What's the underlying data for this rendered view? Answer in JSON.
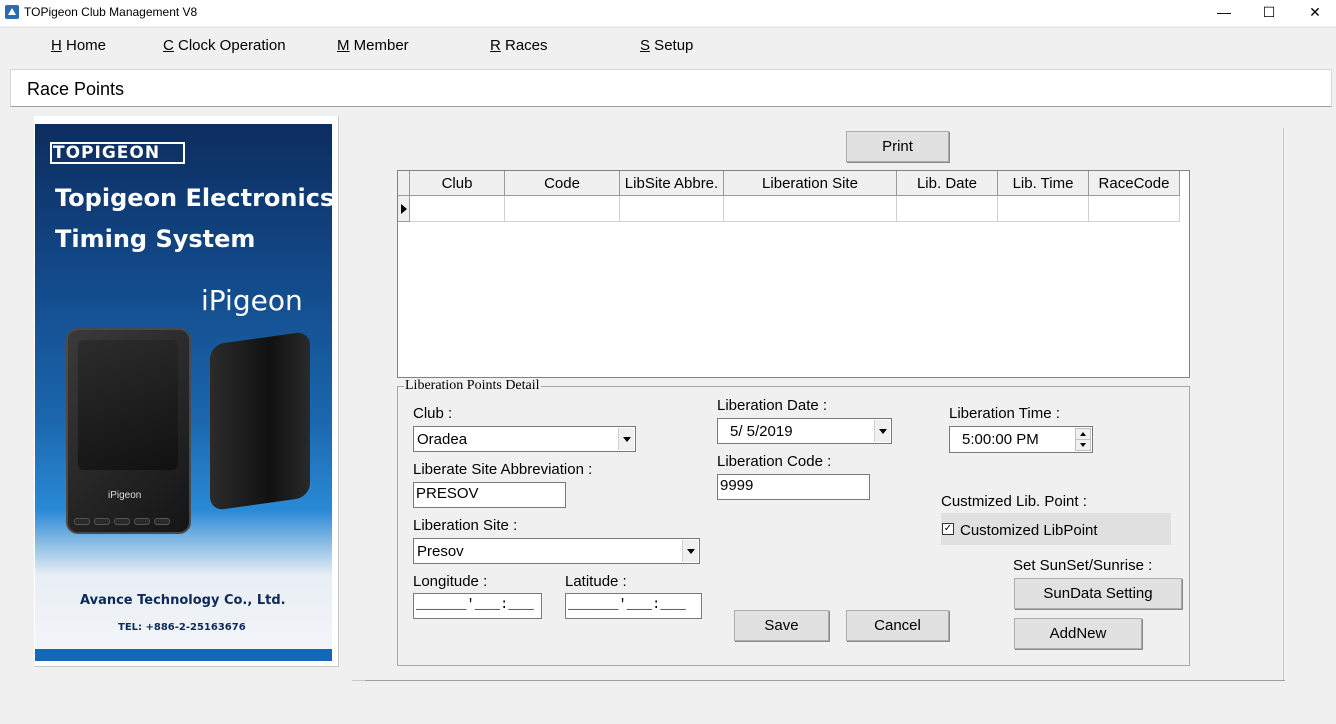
{
  "window": {
    "title": "TOPigeon Club Management V8",
    "controls": {
      "minimize": "—",
      "maximize": "☐",
      "close": "✕"
    }
  },
  "menu": [
    {
      "key": "H",
      "label": " Home"
    },
    {
      "key": "C",
      "label": " Clock Operation"
    },
    {
      "key": "M",
      "label": " Member"
    },
    {
      "key": "R",
      "label": " Races"
    },
    {
      "key": "S",
      "label": " Setup"
    }
  ],
  "page": {
    "title": "Race Points"
  },
  "banner": {
    "logo": "TOPIGEON",
    "headline_1": "Topigeon Electronics",
    "headline_2": "Timing System",
    "product": "iPigeon",
    "device_label": "iPigeon",
    "company": "Avance Technology Co., Ltd.",
    "tel": "TEL: +886-2-25163676",
    "colors": {
      "dark": "#0c2d5e",
      "mid": "#1b67ad",
      "strip": "#1567b8"
    }
  },
  "toolbar": {
    "print_label": "Print"
  },
  "grid": {
    "columns": [
      "Club",
      "Code",
      "LibSite Abbre.",
      "Liberation Site",
      "Lib. Date",
      "Lib. Time",
      "RaceCode"
    ],
    "rows": [
      [
        "",
        "",
        "",
        "",
        "",
        "",
        ""
      ]
    ]
  },
  "detail": {
    "group_label": "Liberation Points Detail",
    "club_label": "Club :",
    "club_value": "Oradea",
    "abbrev_label": "Liberate Site Abbreviation  :",
    "abbrev_value": "PRESOV",
    "site_label": "Liberation Site :",
    "site_value": "Presov",
    "longitude_label": "Longitude :",
    "longitude_value": "______'___:___",
    "latitude_label": "Latitude :",
    "latitude_value": "______'___:___",
    "date_label": "Liberation Date :",
    "date_value": " 5/  5/2019",
    "code_label": "Liberation Code :",
    "code_value": "9999",
    "time_label": "Liberation Time :",
    "time_value": "5:00:00 PM",
    "customized_label": "Custmized Lib. Point :",
    "customized_checkbox_label": "Customized LibPoint",
    "customized_checked": true,
    "sunset_label": "Set SunSet/Sunrise :",
    "sundata_button": "SunData Setting",
    "addnew_button": "AddNew",
    "save_button": "Save",
    "cancel_button": "Cancel"
  }
}
